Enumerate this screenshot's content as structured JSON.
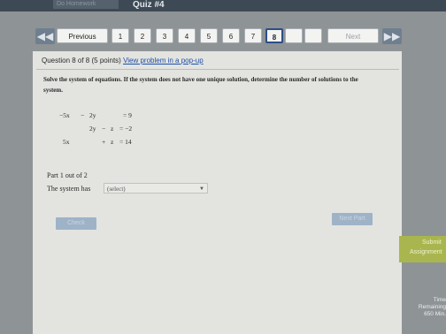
{
  "header": {
    "crumb": "Do Homework",
    "title": "Quiz #4"
  },
  "nav": {
    "previous_label": "Previous",
    "next_label": "Next",
    "questions": [
      "1",
      "2",
      "3",
      "4",
      "5",
      "6",
      "7",
      "8"
    ],
    "current": "8"
  },
  "question": {
    "label": "Question 8 of 8 (5 points)",
    "popup_link": "View problem in a pop-up",
    "instructions": "Solve the system of equations. If the system does not have one unique solution, determine the number of solutions to the system.",
    "equations": {
      "row1": {
        "a": "−5x",
        "op": "−",
        "b": "2y",
        "rhs": "= 9"
      },
      "row2": {
        "a": "2y",
        "op": "−",
        "b": "z",
        "rhs": "= −2"
      },
      "row3": {
        "a": "5x",
        "op": "+",
        "b": "z",
        "rhs": "= 14"
      }
    },
    "part_label": "Part 1 out of 2",
    "system_label": "The system has",
    "select_value": "(select)"
  },
  "buttons": {
    "check": "Check",
    "next_part": "Next Part",
    "submit_line1": "Submit",
    "submit_line2": "Assignment",
    "time_label": "Time Remaining",
    "time_value": "650 Min."
  }
}
